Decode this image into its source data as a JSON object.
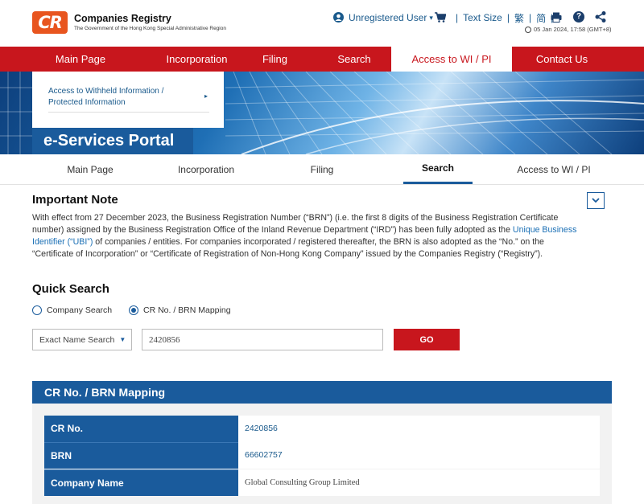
{
  "brand": {
    "logo_text": "CR",
    "title": "Companies Registry",
    "subtitle": "The Government of the Hong Kong Special Administrative Region"
  },
  "utility": {
    "user_label": "Unregistered User",
    "user_caret": "▾",
    "separator": "|",
    "text_size": "Text Size",
    "lang_traditional": "繁",
    "lang_simplified": "简",
    "datetime": "05 Jan 2024, 17:58 (GMT+8)",
    "help_glyph": "?"
  },
  "main_nav": [
    {
      "label": "Main Page"
    },
    {
      "label": "Incorporation"
    },
    {
      "label": "Filing"
    },
    {
      "label": "Search"
    },
    {
      "label": "Access to WI / PI",
      "active": true
    },
    {
      "label": "Contact Us"
    }
  ],
  "banner": {
    "withheld_link": "Access to Withheld Information / Protected Information",
    "chevron": "▸",
    "portal_title": "e-Services Portal"
  },
  "sub_nav": [
    {
      "label": "Main Page"
    },
    {
      "label": "Incorporation"
    },
    {
      "label": "Filing"
    },
    {
      "label": "Search",
      "active": true
    },
    {
      "label": "Access to WI / PI"
    }
  ],
  "note": {
    "title": "Important Note",
    "body_part1": "With effect from 27 December 2023, the Business Registration Number (“BRN”) (i.e. the first 8 digits of the Business Registration Certificate number) assigned by the Business Registration Office of the Inland Revenue Department (“IRD”) has been fully adopted as the ",
    "body_link": "Unique Business Identifier (“UBI”)",
    "body_part2": " of companies / entities. For companies incorporated / registered thereafter, the BRN is also adopted as the “No.” on the “Certificate of Incorporation” or “Certificate of Registration of Non-Hong Kong Company” issued by the Companies Registry (“Registry”)."
  },
  "quick_search": {
    "title": "Quick Search",
    "option_company": "Company Search",
    "option_crno": "CR No. / BRN Mapping",
    "select_value": "Exact Name Search",
    "select_caret": "▼",
    "input_value": "2420856",
    "go_label": "GO"
  },
  "result": {
    "header": "CR No. / BRN Mapping",
    "rows": [
      {
        "label": "CR No.",
        "value": "2420856"
      },
      {
        "label": "BRN",
        "value": "66602757"
      },
      {
        "label": "Company Name",
        "value": "Global Consulting Group Limited"
      }
    ]
  },
  "colors": {
    "brand_red": "#c8161d",
    "brand_blue": "#1a5b9c",
    "logo_orange": "#e8551f"
  }
}
